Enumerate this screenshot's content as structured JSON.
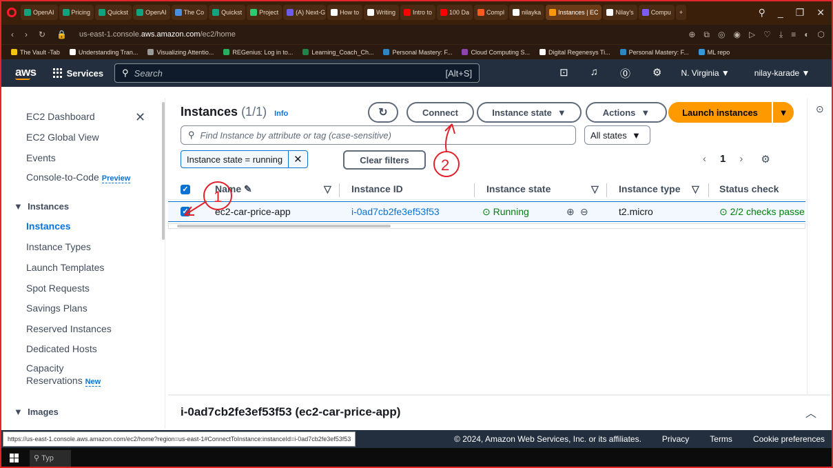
{
  "browser": {
    "tabs": [
      {
        "label": "OpenAI",
        "color": "#10a37f"
      },
      {
        "label": "Pricing",
        "color": "#10a37f"
      },
      {
        "label": "Quickst",
        "color": "#10a37f"
      },
      {
        "label": "OpenAI",
        "color": "#10a37f"
      },
      {
        "label": "The Co",
        "color": "#4a90e2"
      },
      {
        "label": "Quickst",
        "color": "#10a37f"
      },
      {
        "label": "Project",
        "color": "#2ecc71"
      },
      {
        "label": "(A) Next-G",
        "color": "#6c5ce7"
      },
      {
        "label": "How to",
        "color": "#ffffff"
      },
      {
        "label": "Writing",
        "color": "#ffffff"
      },
      {
        "label": "Intro to",
        "color": "#ff0000"
      },
      {
        "label": "100 Da",
        "color": "#ff0000"
      },
      {
        "label": "Compl",
        "color": "#ff5a1f"
      },
      {
        "label": "nilayka",
        "color": "#ffffff"
      },
      {
        "label": "Instances | EC",
        "color": "#ff9900",
        "active": true
      },
      {
        "label": "Nilay's",
        "color": "#ffffff"
      },
      {
        "label": "Compu",
        "color": "#7b5cff"
      }
    ],
    "url_prefix": "us-east-1.console.",
    "url_domain": "aws.amazon.com",
    "url_path": "/ec2/home",
    "bookmarks": [
      {
        "label": "The Vault -Tab",
        "color": "#f1c40f"
      },
      {
        "label": "Understanding Tran...",
        "color": "#ffffff"
      },
      {
        "label": "Visualizing Attentio...",
        "color": "#999999"
      },
      {
        "label": "REGenius: Log in to...",
        "color": "#27ae60"
      },
      {
        "label": "Learning_Coach_Ch...",
        "color": "#1e8449"
      },
      {
        "label": "Personal Mastery: F...",
        "color": "#2e86c1"
      },
      {
        "label": "Cloud Computing S...",
        "color": "#8e44ad"
      },
      {
        "label": "Digital Regenesys Ti...",
        "color": "#ffffff"
      },
      {
        "label": "Personal Mastery: F...",
        "color": "#2e86c1"
      },
      {
        "label": "ML repo",
        "color": "#3498db"
      }
    ]
  },
  "aws_nav": {
    "logo": "aws",
    "services": "Services",
    "search_placeholder": "Search",
    "search_shortcut": "[Alt+S]",
    "region": "N. Virginia ▼",
    "user": "nilay-karade ▼"
  },
  "sidebar": {
    "items": [
      {
        "label": "EC2 Dashboard"
      },
      {
        "label": "EC2 Global View"
      },
      {
        "label": "Events"
      },
      {
        "label": "Console-to-Code",
        "badge": "Preview"
      }
    ],
    "section_instances": "Instances",
    "instances_items": [
      "Instances",
      "Instance Types",
      "Launch Templates",
      "Spot Requests",
      "Savings Plans",
      "Reserved Instances",
      "Dedicated Hosts"
    ],
    "capacity_1": "Capacity",
    "capacity_2": "Reservations",
    "capacity_badge": "New",
    "section_images": "Images"
  },
  "main": {
    "title": "Instances",
    "count": "(1/1)",
    "info": "Info",
    "connect": "Connect",
    "instance_state": "Instance state",
    "actions": "Actions",
    "launch": "Launch instances",
    "filter_placeholder": "Find Instance by attribute or tag (case-sensitive)",
    "states_select": "All states",
    "chip_label": "Instance state = running",
    "clear_filters": "Clear filters",
    "page": "1",
    "columns": [
      "Name",
      "Instance ID",
      "Instance state",
      "Instance type",
      "Status check"
    ],
    "row": {
      "name": "ec2-car-price-app",
      "instance_id": "i-0ad7cb2fe3ef53f53",
      "state": "Running",
      "type": "t2.micro",
      "status": "2/2 checks passe"
    }
  },
  "panel": {
    "title": "i-0ad7cb2fe3ef53f53 (ec2-car-price-app)"
  },
  "footer": {
    "status_url": "https://us-east-1.console.aws.amazon.com/ec2/home?region=us-east-1#ConnectToInstance:instanceId=i-0ad7cb2fe3ef53f53",
    "copyright": "© 2024, Amazon Web Services, Inc. or its affiliates.",
    "privacy": "Privacy",
    "terms": "Terms",
    "cookies": "Cookie preferences"
  },
  "taskbar": {
    "search": "Typ"
  },
  "annotations": {
    "step1": "1",
    "step2": "2",
    "color": "#e0202a"
  }
}
